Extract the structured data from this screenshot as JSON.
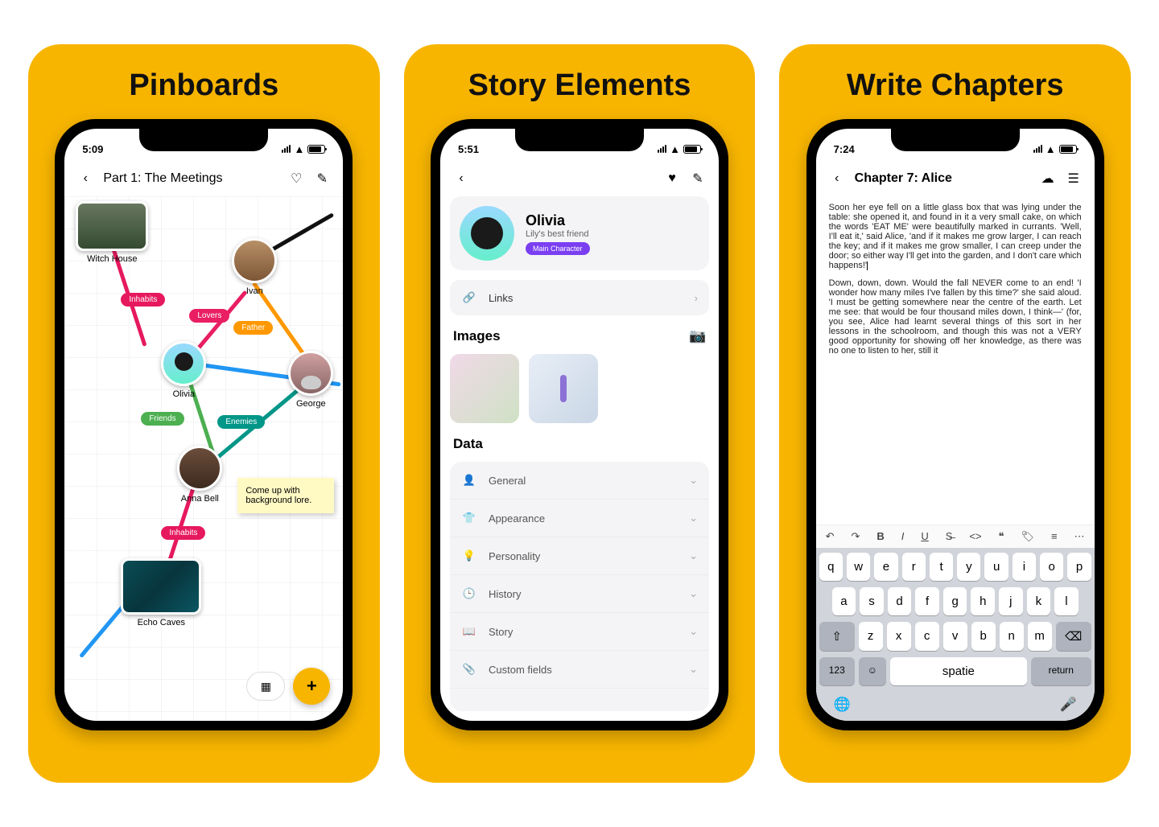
{
  "cards": {
    "pinboards": {
      "title": "Pinboards",
      "status_time": "5:09",
      "nav_title": "Part 1: The Meetings",
      "nodes": {
        "witch_house": "Witch House",
        "ivan": "Ivan",
        "olivia": "Olivia",
        "george": "George",
        "anna": "Anna Bell",
        "echo": "Echo Caves"
      },
      "relations": {
        "inhabits": "Inhabits",
        "lovers": "Lovers",
        "father": "Father",
        "friends": "Friends",
        "enemies": "Enemies",
        "inhabits2": "Inhabits"
      },
      "sticky": "Come up with background lore.",
      "fab_plus": "+"
    },
    "story_elements": {
      "title": "Story Elements",
      "status_time": "5:51",
      "profile": {
        "name": "Olivia",
        "subtitle": "Lily's best friend",
        "badge": "Main Character"
      },
      "links_label": "Links",
      "images_label": "Images",
      "data_label": "Data",
      "data_items": [
        "General",
        "Appearance",
        "Personality",
        "History",
        "Story",
        "Custom fields"
      ]
    },
    "write_chapters": {
      "title": "Write Chapters",
      "status_time": "7:24",
      "nav_title": "Chapter 7: Alice",
      "para1": "Soon her eye fell on a little glass box that was lying under the table: she opened it, and found in it a very small cake, on which the words 'EAT ME' were beautifully marked in currants. 'Well, I'll eat it,' said Alice, 'and if it makes me grow larger, I can reach the key; and if it makes me grow smaller, I can creep under the door; so either way I'll get into the garden, and I don't care which happens!'",
      "para2": "Down, down, down. Would the fall NEVER come to an end! 'I wonder how many miles I've fallen by this time?' she said aloud. 'I must be getting somewhere near the centre of the earth. Let me see: that would be four thousand miles down, I think—' (for, you see, Alice had learnt several things of this sort in her lessons in the schoolroom, and though this was not a VERY good opportunity for showing off her knowledge, as there was no one to listen to her, still it",
      "keyboard": {
        "row1": [
          "q",
          "w",
          "e",
          "r",
          "t",
          "y",
          "u",
          "i",
          "o",
          "p"
        ],
        "row2": [
          "a",
          "s",
          "d",
          "f",
          "g",
          "h",
          "j",
          "k",
          "l"
        ],
        "row3": [
          "z",
          "x",
          "c",
          "v",
          "b",
          "n",
          "m"
        ],
        "num": "123",
        "space": "spatie",
        "return": "return"
      }
    }
  }
}
